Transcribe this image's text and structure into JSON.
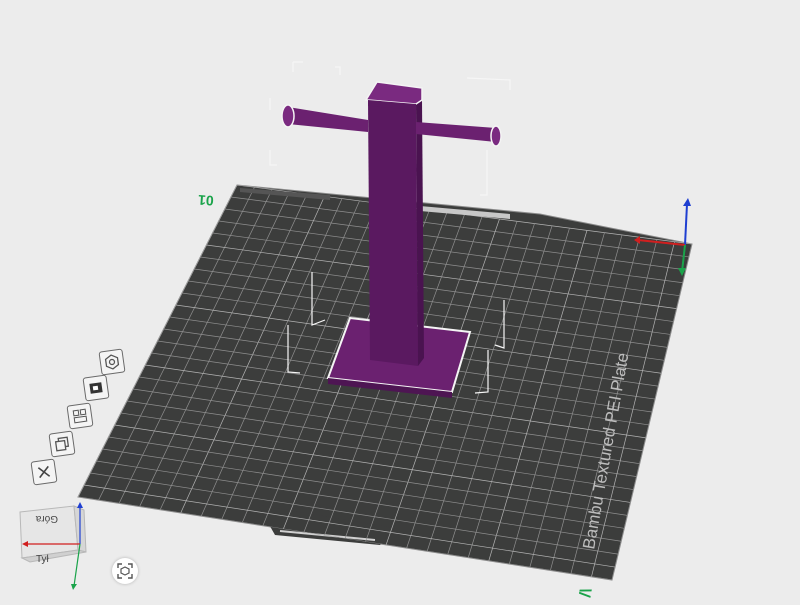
{
  "plate": {
    "label": "Bambu Textured PEI Plate",
    "number": "01"
  },
  "view_cube": {
    "top_face": "Góra",
    "front_face": "Tył"
  },
  "colors": {
    "plate": "#3c3d3c",
    "grid": "#9a9a9a",
    "model": "#6b2170",
    "model_dark": "#4e1553",
    "model_light": "#8a3390",
    "axis_x": "#d11f1f",
    "axis_y": "#1aa34a",
    "axis_z": "#1f3fd1",
    "background": "#ececec"
  },
  "toolbar": {
    "items": [
      {
        "name": "orient-icon"
      },
      {
        "name": "color-paint-icon"
      },
      {
        "name": "arrange-icon"
      },
      {
        "name": "layers-icon"
      },
      {
        "name": "close-icon"
      }
    ]
  }
}
